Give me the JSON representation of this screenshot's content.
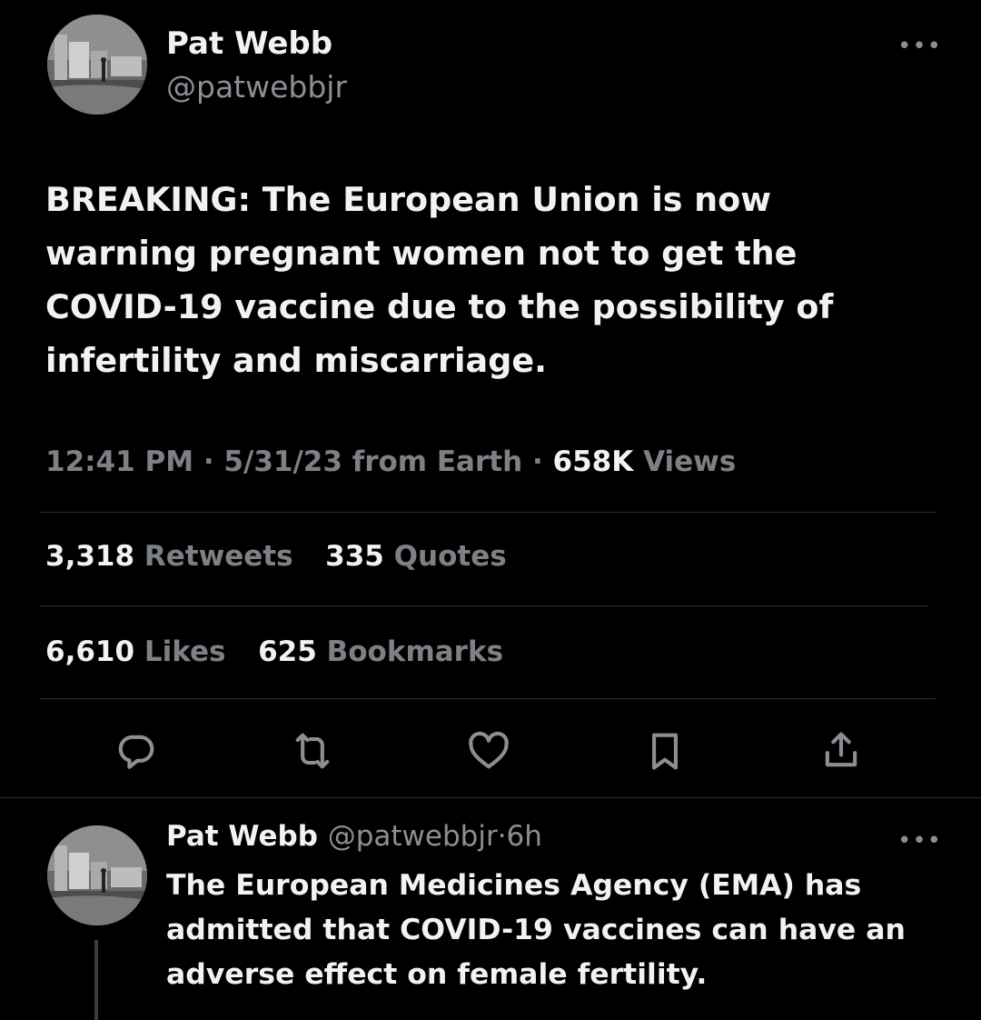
{
  "main_tweet": {
    "author_name": "Pat Webb",
    "author_handle": "@patwebbjr",
    "more_label": "•••",
    "text": "BREAKING: The European Union is now warning pregnant women not to get the COVID-19 vaccine due to the possibility of infertility and miscarriage.",
    "time": "12:41 PM",
    "date": "5/31/23",
    "source": "from Earth",
    "separator": "·",
    "views_count": "658K",
    "views_label": "Views",
    "stats_row1": [
      {
        "count": "3,318",
        "label": "Retweets"
      },
      {
        "count": "335",
        "label": "Quotes"
      }
    ],
    "stats_row2": [
      {
        "count": "6,610",
        "label": "Likes"
      },
      {
        "count": "625",
        "label": "Bookmarks"
      }
    ],
    "actions": [
      "reply-icon",
      "retweet-icon",
      "like-icon",
      "bookmark-icon",
      "share-icon"
    ]
  },
  "reply_tweet": {
    "author_name": "Pat Webb",
    "author_handle": "@patwebbjr",
    "separator": "·",
    "age": "6h",
    "more_label": "•••",
    "text": "The European Medicines Agency (EMA) has admitted that COVID-19 vaccines can have an adverse effect on female fertility."
  },
  "colors": {
    "background": "#000000",
    "primary_text": "#f2f2f2",
    "secondary_text": "#8b8f94",
    "divider": "#2b2e32"
  }
}
